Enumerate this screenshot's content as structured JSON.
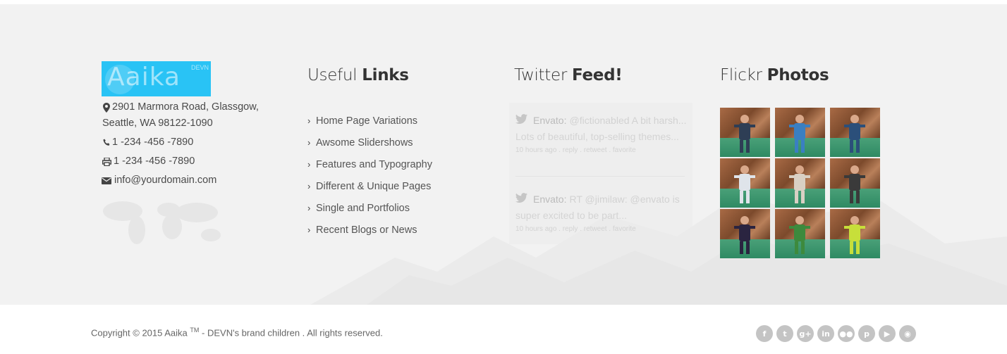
{
  "brand": {
    "logo_text": "Aaika",
    "logo_sub": "DEVN"
  },
  "contact": {
    "address_line1": "2901 Marmora Road, Glassgow,",
    "address_line2": "Seattle, WA 98122-1090",
    "phone": "1 -234 -456 -7890",
    "fax": "1 -234 -456 -7890",
    "email": "info@yourdomain.com",
    "icons": [
      "map-marker-icon",
      "phone-icon",
      "printer-icon",
      "envelope-icon"
    ]
  },
  "useful_links": {
    "heading_light": "Useful",
    "heading_bold": "Links",
    "items": [
      "Home Page Variations",
      "Awsome Slidershows",
      "Features and Typography",
      "Different & Unique Pages",
      "Single and Portfolios",
      "Recent Blogs or News"
    ]
  },
  "twitter": {
    "heading_light": "Twitter",
    "heading_bold": "Feed!",
    "tweets": [
      {
        "author": "Envato:",
        "text_line1": "@fictionabled A bit harsh...",
        "text_line2": "Lots of beautiful, top-selling themes...",
        "time": "10 hours ago",
        "reply": "reply",
        "retweet": "retweet",
        "favorite": "favorite"
      },
      {
        "author": "Envato:",
        "text_line1": "RT @jimilaw: @envato is",
        "text_line2": "super excited to be part...",
        "time": "10 hours ago",
        "reply": "reply",
        "retweet": "retweet",
        "favorite": "favorite"
      }
    ]
  },
  "flickr": {
    "heading_light": "Flickr",
    "heading_bold": "Photos",
    "photo_count": 9
  },
  "footer": {
    "copyright_pre": "Copyright © 2015 Aaika",
    "copyright_tm": "TM",
    "copyright_post": "- DEVN's brand children . All rights reserved."
  },
  "social": [
    {
      "name": "facebook-icon",
      "glyph": "f"
    },
    {
      "name": "twitter-icon",
      "glyph": "t"
    },
    {
      "name": "google-plus-icon",
      "glyph": "g+"
    },
    {
      "name": "linkedin-icon",
      "glyph": "in"
    },
    {
      "name": "flickr-icon",
      "glyph": "●●"
    },
    {
      "name": "pinterest-icon",
      "glyph": "p"
    },
    {
      "name": "youtube-icon",
      "glyph": "▶"
    },
    {
      "name": "rss-icon",
      "glyph": "◉"
    }
  ],
  "colors": {
    "logo_bg": "#29c3f5",
    "footer_bg": "#f2f2f2",
    "social_bg": "#c4c4c4"
  }
}
